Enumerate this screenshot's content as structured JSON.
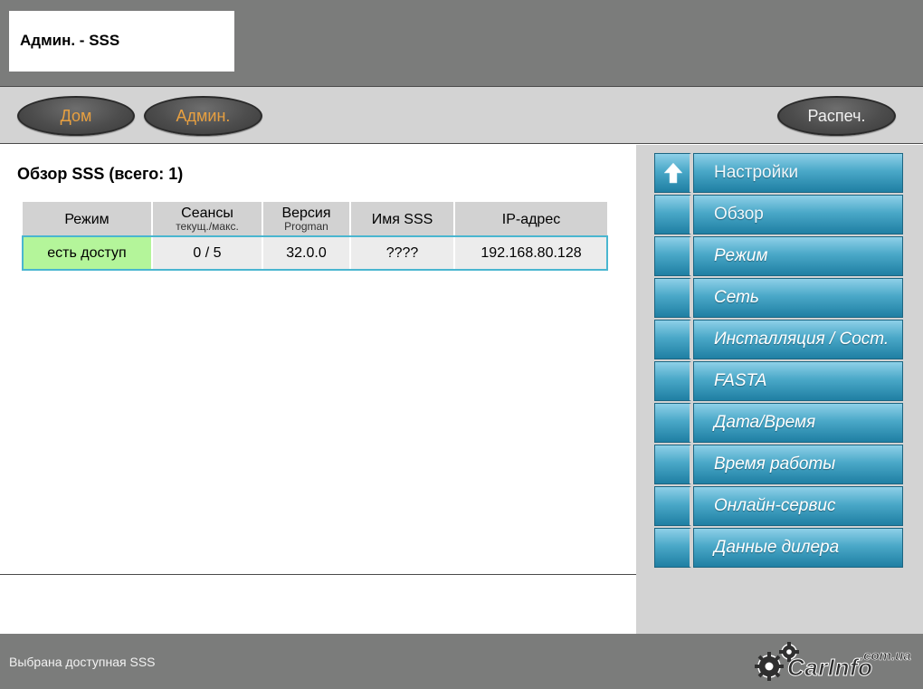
{
  "window": {
    "title": "Админ. - SSS"
  },
  "nav": {
    "home_label": "Дом",
    "admin_label": "Админ.",
    "print_label": "Распеч."
  },
  "main": {
    "heading": "Обзор SSS (всего: 1)",
    "table": {
      "columns": [
        {
          "label": "Режим",
          "sub": ""
        },
        {
          "label": "Сеансы",
          "sub": "текущ./макс."
        },
        {
          "label": "Версия",
          "sub": "Progman"
        },
        {
          "label": "Имя SSS",
          "sub": ""
        },
        {
          "label": "IP-адрес",
          "sub": ""
        }
      ],
      "rows": [
        {
          "mode": "есть доступ",
          "sessions": "0 / 5",
          "version": "32.0.0",
          "name": "????",
          "ip": "192.168.80.128"
        }
      ]
    }
  },
  "menu": {
    "items": [
      {
        "label": "Настройки",
        "icon": "up-arrow-icon"
      },
      {
        "label": "Обзор"
      },
      {
        "label": "Режим"
      },
      {
        "label": "Сеть"
      },
      {
        "label": "Инсталляция / Сост."
      },
      {
        "label": "FASTA"
      },
      {
        "label": "Дата/Время"
      },
      {
        "label": "Время работы"
      },
      {
        "label": "Онлайн-сервис"
      },
      {
        "label": "Данные дилера"
      }
    ]
  },
  "footer": {
    "status": "Выбрана доступная SSS",
    "logo_text": "CarInfo",
    "logo_domain": ".com.ua"
  },
  "colors": {
    "accent_orange": "#e8a040",
    "menu_blue": "#4aa8c8",
    "status_ok_green": "#b4f59a",
    "row_outline": "#4ab6d0"
  }
}
